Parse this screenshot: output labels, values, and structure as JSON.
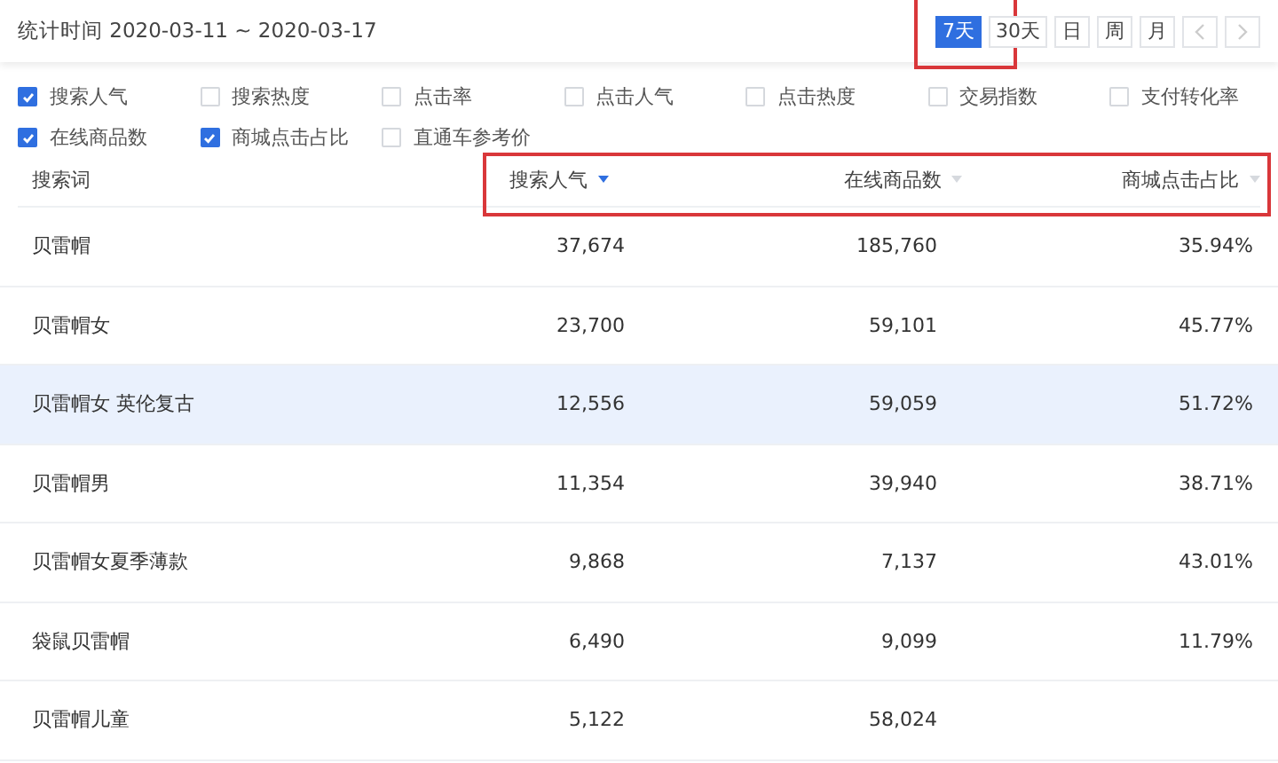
{
  "header": {
    "period_label": "统计时间 2020-03-11 ~ 2020-03-17",
    "ranges": [
      {
        "label": "7天",
        "selected": true,
        "highlighted": true
      },
      {
        "label": "30天",
        "selected": false,
        "highlighted": false
      },
      {
        "label": "日",
        "selected": false,
        "highlighted": false
      },
      {
        "label": "周",
        "selected": false,
        "highlighted": false
      },
      {
        "label": "月",
        "selected": false,
        "highlighted": false
      }
    ]
  },
  "metrics": [
    {
      "label": "搜索人气",
      "checked": true
    },
    {
      "label": "搜索热度",
      "checked": false
    },
    {
      "label": "点击率",
      "checked": false
    },
    {
      "label": "点击人气",
      "checked": false
    },
    {
      "label": "点击热度",
      "checked": false
    },
    {
      "label": "交易指数",
      "checked": false
    },
    {
      "label": "支付转化率",
      "checked": false
    },
    {
      "label": "在线商品数",
      "checked": true
    },
    {
      "label": "商城点击占比",
      "checked": true
    },
    {
      "label": "直通车参考价",
      "checked": false
    }
  ],
  "table": {
    "metric_columns_highlighted": true,
    "columns": [
      {
        "label": "搜索词"
      },
      {
        "label": "搜索人气",
        "sort_active": true
      },
      {
        "label": "在线商品数",
        "sort_active": false
      },
      {
        "label": "商城点击占比",
        "sort_active": false
      }
    ],
    "rows": [
      {
        "cells": [
          "贝雷帽",
          "37,674",
          "185,760",
          "35.94%"
        ],
        "selected": false
      },
      {
        "cells": [
          "贝雷帽女",
          "23,700",
          "59,101",
          "45.77%"
        ],
        "selected": false
      },
      {
        "cells": [
          "贝雷帽女 英伦复古",
          "12,556",
          "59,059",
          "51.72%"
        ],
        "selected": true
      },
      {
        "cells": [
          "贝雷帽男",
          "11,354",
          "39,940",
          "38.71%"
        ],
        "selected": false
      },
      {
        "cells": [
          "贝雷帽女夏季薄款",
          "9,868",
          "7,137",
          "43.01%"
        ],
        "selected": false
      },
      {
        "cells": [
          "袋鼠贝雷帽",
          "6,490",
          "9,099",
          "11.79%"
        ],
        "selected": false
      },
      {
        "cells": [
          "贝雷帽儿童",
          "5,122",
          "58,024"
        ],
        "selected": false
      }
    ]
  }
}
